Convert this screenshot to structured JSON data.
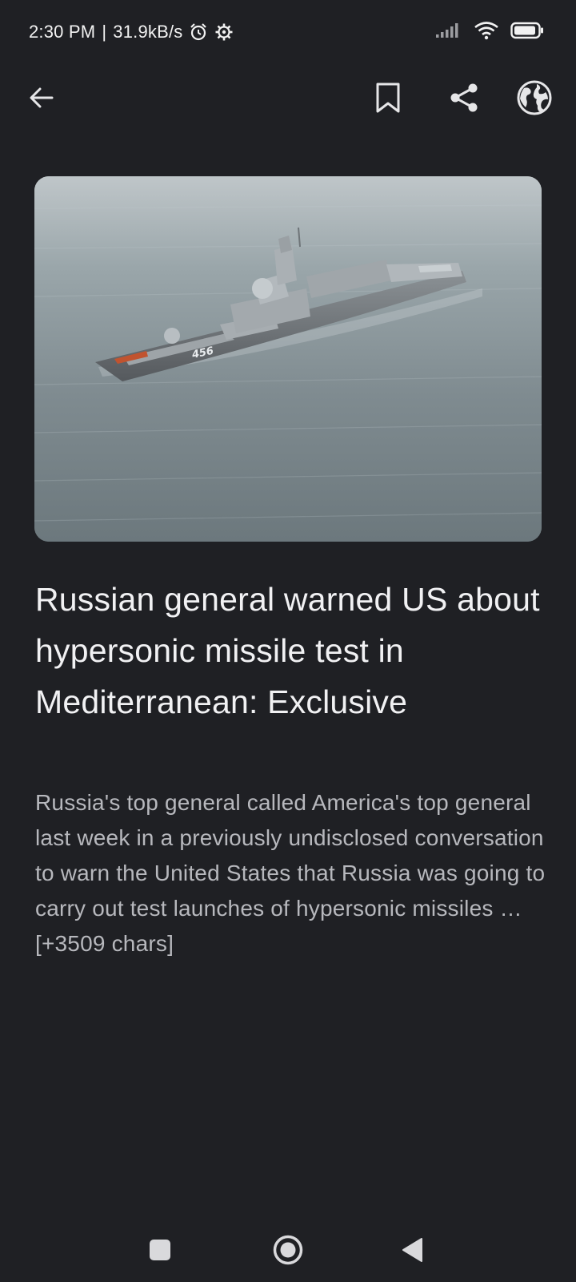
{
  "status_bar": {
    "time": "2:30 PM",
    "separator": "|",
    "net_speed": "31.9kB/s",
    "icons": [
      "alarm-icon",
      "settings-gear-icon",
      "signal-icon",
      "wifi-icon",
      "battery-icon"
    ]
  },
  "toolbar": {
    "icons": [
      "back-arrow-icon",
      "bookmark-icon",
      "share-icon",
      "globe-icon"
    ]
  },
  "article": {
    "image_alt": "Warship with hull number 456 at sea",
    "hull_number": "456",
    "title": "Russian general warned US about hypersonic missile test in Mediterranean: Exclusive",
    "body": "Russia's top general called America's top general last week in a previously undisclosed conversation to warn the United States that Russia was going to carry out test launches of hypersonic missiles … [+3509 chars]"
  },
  "nav_bar": {
    "icons": [
      "recents-square-icon",
      "home-circle-icon",
      "back-triangle-icon"
    ]
  },
  "colors": {
    "background": "#1f2024",
    "title": "#f1f1f3",
    "body": "#b7b8bd",
    "icon": "#e6e6e8"
  }
}
